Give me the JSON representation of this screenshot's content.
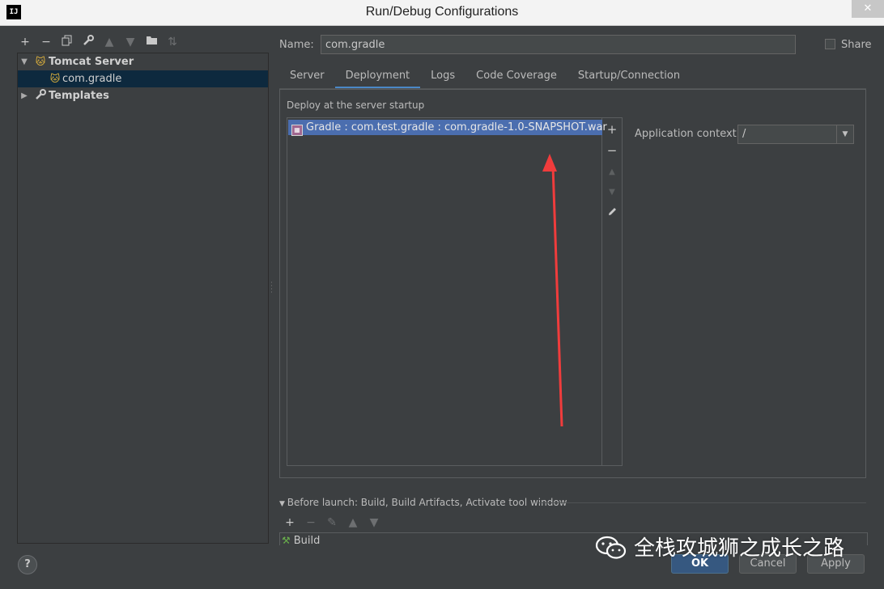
{
  "window": {
    "app_icon": "IJ",
    "title": "Run/Debug Configurations",
    "close_glyph": "✕"
  },
  "left_toolbar": {
    "icons": [
      "plus-icon",
      "minus-icon",
      "copy-icon",
      "wrench-icon",
      "arrow-up-icon",
      "arrow-down-icon",
      "folder-icon",
      "sort-icon"
    ]
  },
  "tree": {
    "items": [
      {
        "label": "Tomcat Server",
        "icon": "tomcat-icon",
        "expanded": true
      },
      {
        "label": "com.gradle",
        "icon": "tomcat-icon",
        "selected": true
      },
      {
        "label": "Templates",
        "icon": "wrench-icon",
        "expanded": false
      }
    ]
  },
  "form": {
    "name_label": "Name:",
    "name_value": "com.gradle",
    "share_label": "Share"
  },
  "tabs": [
    {
      "label": "Server"
    },
    {
      "label": "Deployment",
      "active": true
    },
    {
      "label": "Logs"
    },
    {
      "label": "Code Coverage"
    },
    {
      "label": "Startup/Connection"
    }
  ],
  "deployment": {
    "group_title": "Deploy at the server startup",
    "artifacts": [
      "Gradle : com.test.gradle : com.gradle-1.0-SNAPSHOT.war"
    ],
    "context_label": "Application context:",
    "context_value": "/"
  },
  "before_launch": {
    "header": "Before launch: Build, Build Artifacts, Activate tool window",
    "items": [
      "Build"
    ]
  },
  "buttons": {
    "help": "?",
    "ok": "OK",
    "cancel": "Cancel",
    "apply": "Apply"
  },
  "watermark": {
    "text": "全栈攻城狮之成长之路",
    "icon": "wechat-icon"
  },
  "colors": {
    "accent": "#4a88c7",
    "selection": "#4b6eaf",
    "annotation_arrow": "#f03c3c"
  }
}
